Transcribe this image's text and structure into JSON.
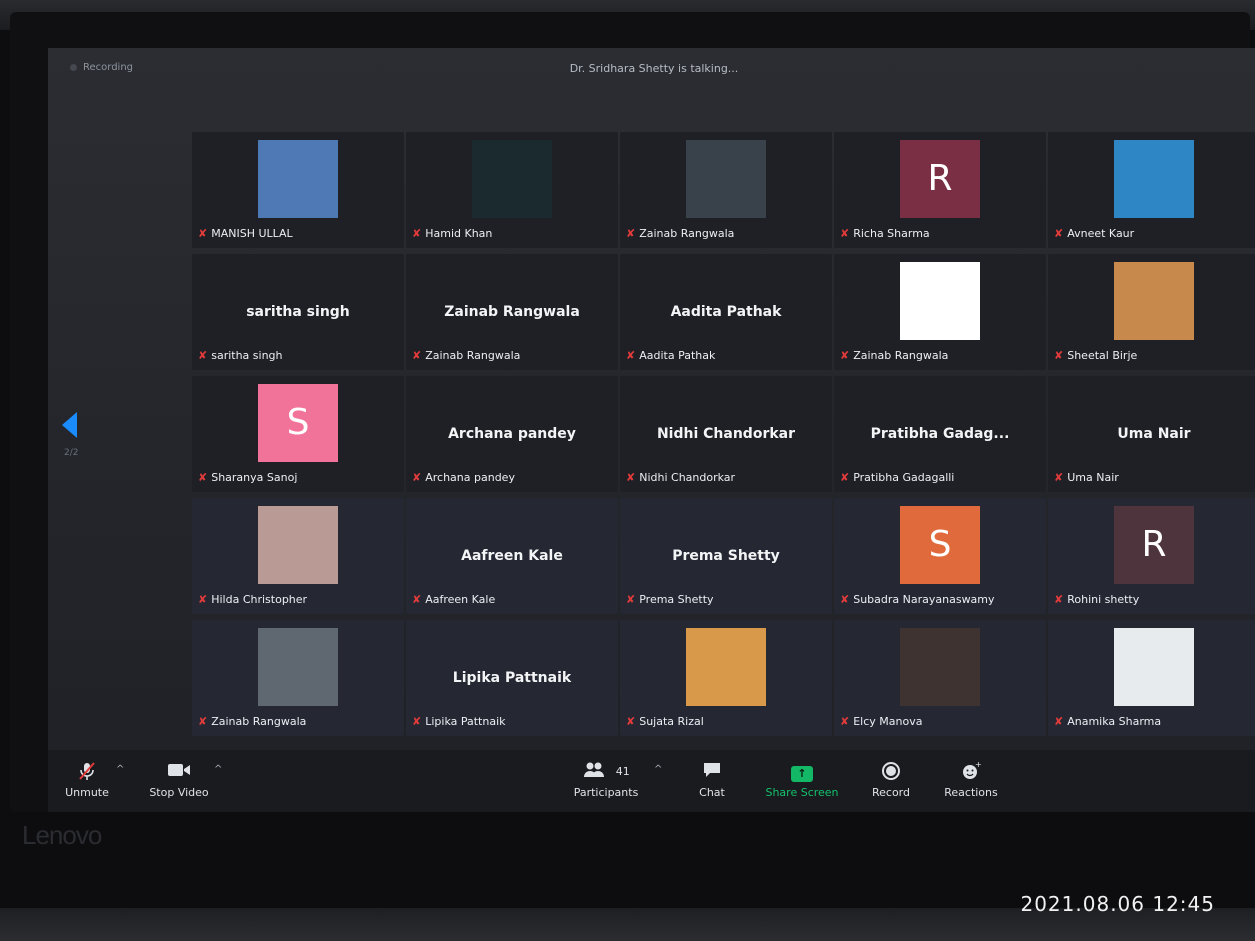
{
  "meeting": {
    "recording": "Recording",
    "talking": "Dr. Sridhara Shetty is talking...",
    "page": "2/2"
  },
  "participants": [
    {
      "name": "MANISH ULLAL",
      "kind": "photo",
      "color": "#4f79b5"
    },
    {
      "name": "Hamid Khan",
      "kind": "photo",
      "color": "#1a2a2e"
    },
    {
      "name": "Zainab Rangwala",
      "kind": "photo",
      "color": "#39414a"
    },
    {
      "name": "Richa Sharma",
      "kind": "initial",
      "initial": "R",
      "color": "#7a2f45"
    },
    {
      "name": "Avneet Kaur",
      "kind": "photo",
      "color": "#2f86c4"
    },
    {
      "name": "saritha singh",
      "display": "saritha singh",
      "kind": "name"
    },
    {
      "name": "Zainab Rangwala",
      "display": "Zainab Rangwala",
      "kind": "name"
    },
    {
      "name": "Aadita Pathak",
      "display": "Aadita Pathak",
      "kind": "name"
    },
    {
      "name": "Zainab Rangwala",
      "kind": "photo",
      "color": "#ffffff"
    },
    {
      "name": "Sheetal Birje",
      "kind": "photo",
      "color": "#c78a4c"
    },
    {
      "name": "Sharanya Sanoj",
      "kind": "initial",
      "initial": "S",
      "color": "#f2739a"
    },
    {
      "name": "Archana pandey",
      "display": "Archana pandey",
      "kind": "name"
    },
    {
      "name": "Nidhi Chandorkar",
      "display": "Nidhi Chandorkar",
      "kind": "name"
    },
    {
      "name": "Pratibha Gadagalli",
      "display": "Pratibha  Gadag...",
      "kind": "name"
    },
    {
      "name": "Uma Nair",
      "display": "Uma Nair",
      "kind": "name"
    },
    {
      "name": "Hilda Christopher",
      "kind": "photo",
      "color": "#b99a95"
    },
    {
      "name": "Aafreen Kale",
      "display": "Aafreen Kale",
      "kind": "name"
    },
    {
      "name": "Prema Shetty",
      "display": "Prema Shetty",
      "kind": "name"
    },
    {
      "name": "Subadra Narayanaswamy",
      "kind": "initial",
      "initial": "S",
      "color": "#e06a3c"
    },
    {
      "name": "Rohini shetty",
      "kind": "initial",
      "initial": "R",
      "color": "#4e353d"
    },
    {
      "name": "Zainab Rangwala",
      "kind": "photo",
      "color": "#5f6870"
    },
    {
      "name": "Lipika Pattnaik",
      "display": "Lipika Pattnaik",
      "kind": "name"
    },
    {
      "name": "Sujata Rizal",
      "kind": "photo",
      "color": "#d89a4a"
    },
    {
      "name": "Elcy Manova",
      "kind": "photo",
      "color": "#3e3330"
    },
    {
      "name": "Anamika Sharma",
      "kind": "photo",
      "color": "#e8ebee"
    }
  ],
  "toolbar": {
    "unmute": "Unmute",
    "stop_video": "Stop Video",
    "participants": "Participants",
    "participant_count": "41",
    "chat": "Chat",
    "share_screen": "Share Screen",
    "record": "Record",
    "reactions": "Reactions"
  },
  "icons": {
    "mic_muted": "mic-muted-icon",
    "camera": "camera-icon",
    "participants": "people-icon",
    "chat": "chat-bubble-icon",
    "share": "share-screen-icon",
    "record": "record-icon",
    "reactions": "smile-plus-icon"
  },
  "colors": {
    "accent": "#1a8cff",
    "share_green": "#12c16b",
    "muted_red": "#e23b3b"
  },
  "device": {
    "brand": "Lenovo"
  },
  "photo_timestamp": "2021.08.06 12:45"
}
